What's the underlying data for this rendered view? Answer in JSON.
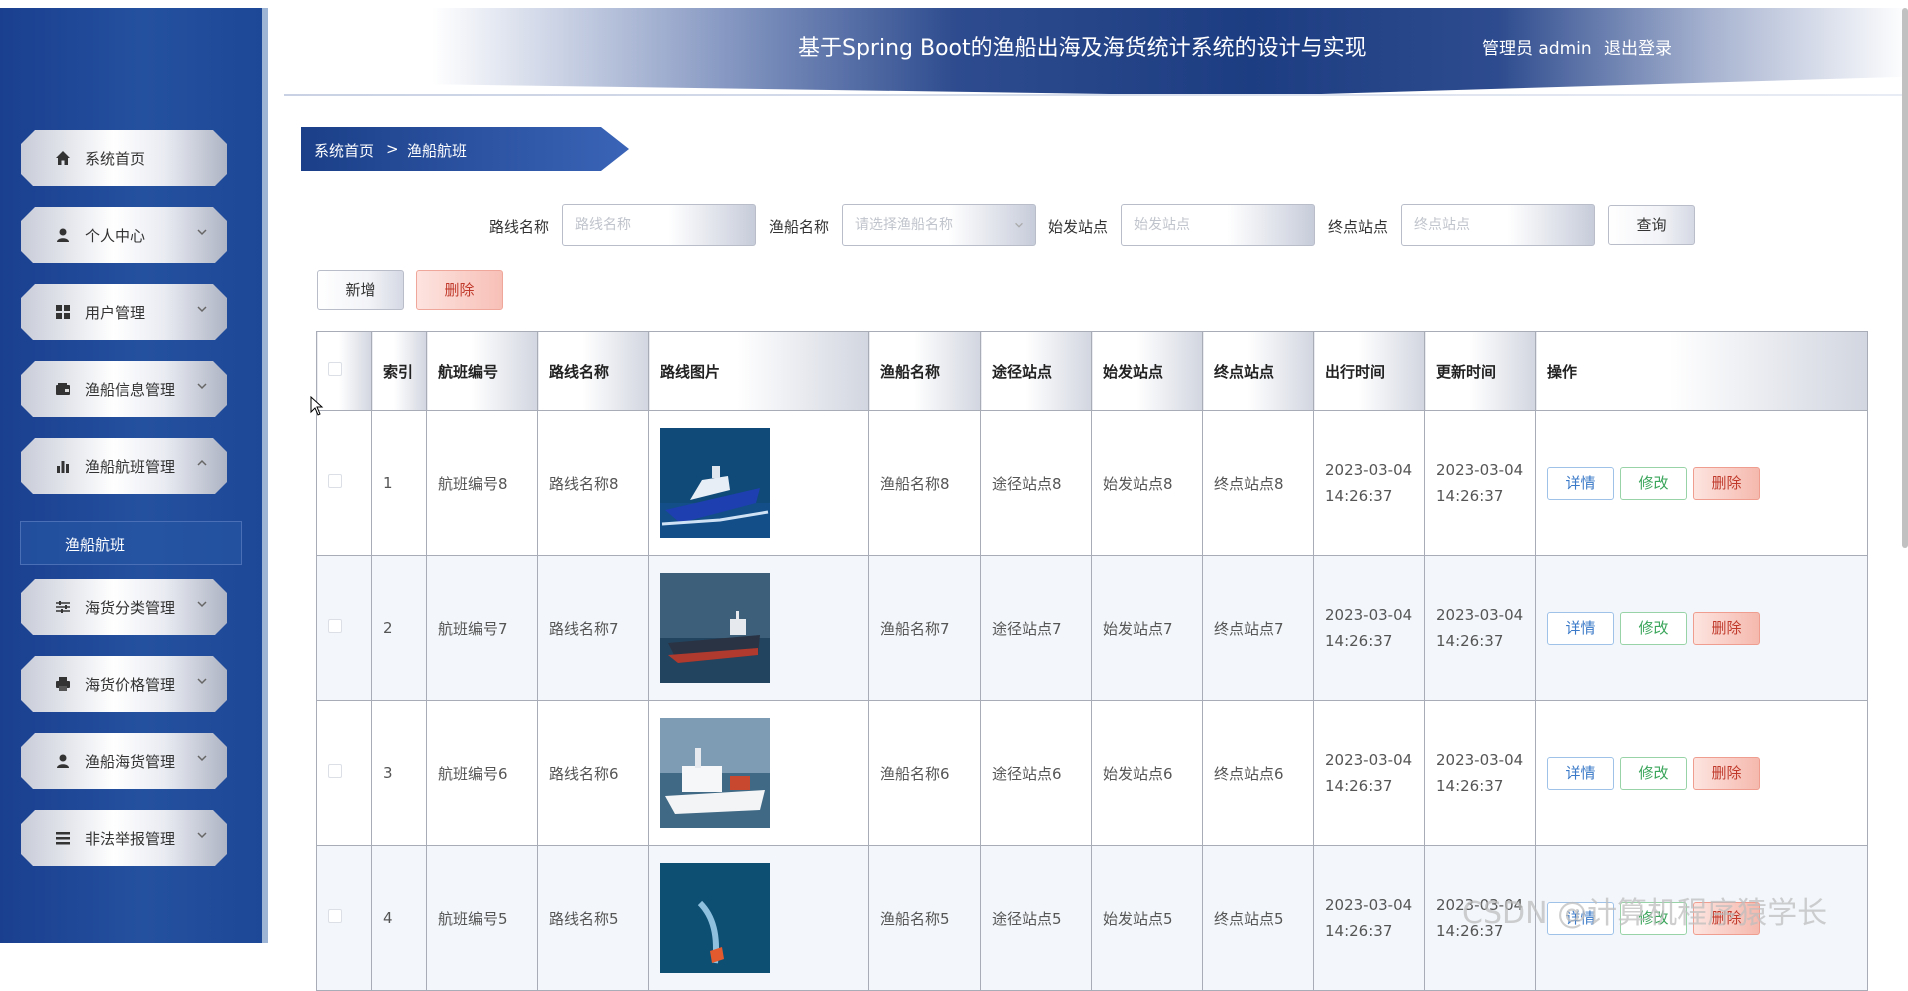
{
  "header": {
    "title": "基于Spring Boot的渔船出海及海货统计系统的设计与实现",
    "user": "管理员 admin",
    "logout": "退出登录"
  },
  "sidebar": {
    "items": [
      {
        "label": "系统首页",
        "icon": "home-icon"
      },
      {
        "label": "个人中心",
        "icon": "user-icon"
      },
      {
        "label": "用户管理",
        "icon": "grid-icon"
      },
      {
        "label": "渔船信息管理",
        "icon": "wallet-icon"
      },
      {
        "label": "渔船航班管理",
        "icon": "bar-chart-icon"
      },
      {
        "label": "海货分类管理",
        "icon": "sliders-icon"
      },
      {
        "label": "海货价格管理",
        "icon": "printer-icon"
      },
      {
        "label": "渔船海货管理",
        "icon": "user-icon"
      },
      {
        "label": "非法举报管理",
        "icon": "list-icon"
      }
    ],
    "submenu_item": "渔船航班"
  },
  "breadcrumb": {
    "home": "系统首页",
    "sep": ">",
    "current": "渔船航班"
  },
  "search": {
    "route_label": "路线名称",
    "route_placeholder": "路线名称",
    "boat_label": "渔船名称",
    "boat_placeholder": "请选择渔船名称",
    "start_label": "始发站点",
    "start_placeholder": "始发站点",
    "end_label": "终点站点",
    "end_placeholder": "终点站点",
    "query_button": "查询"
  },
  "actions": {
    "add": "新增",
    "delete": "删除"
  },
  "table": {
    "headers": {
      "index": "索引",
      "flight_no": "航班编号",
      "route_name": "路线名称",
      "route_image": "路线图片",
      "boat_name": "渔船名称",
      "via": "途径站点",
      "start": "始发站点",
      "end": "终点站点",
      "depart_time": "出行时间",
      "update_time": "更新时间",
      "ops": "操作"
    },
    "rows": [
      {
        "index": "1",
        "flight_no": "航班编号8",
        "route_name": "路线名称8",
        "boat_name": "渔船名称8",
        "via": "途径站点8",
        "start": "始发站点8",
        "end": "终点站点8",
        "depart_date": "2023-03-04",
        "depart_clock": "14:26:37",
        "update_date": "2023-03-04",
        "update_clock": "14:26:37"
      },
      {
        "index": "2",
        "flight_no": "航班编号7",
        "route_name": "路线名称7",
        "boat_name": "渔船名称7",
        "via": "途径站点7",
        "start": "始发站点7",
        "end": "终点站点7",
        "depart_date": "2023-03-04",
        "depart_clock": "14:26:37",
        "update_date": "2023-03-04",
        "update_clock": "14:26:37"
      },
      {
        "index": "3",
        "flight_no": "航班编号6",
        "route_name": "路线名称6",
        "boat_name": "渔船名称6",
        "via": "途径站点6",
        "start": "始发站点6",
        "end": "终点站点6",
        "depart_date": "2023-03-04",
        "depart_clock": "14:26:37",
        "update_date": "2023-03-04",
        "update_clock": "14:26:37"
      },
      {
        "index": "4",
        "flight_no": "航班编号5",
        "route_name": "路线名称5",
        "boat_name": "渔船名称5",
        "via": "途径站点5",
        "start": "始发站点5",
        "end": "终点站点5",
        "depart_date": "2023-03-04",
        "depart_clock": "14:26:37",
        "update_date": "2023-03-04",
        "update_clock": "14:26:37"
      }
    ],
    "row_actions": {
      "detail": "详情",
      "edit": "修改",
      "delete": "删除"
    }
  },
  "watermark": "CSDN @计算机程序猿学长",
  "colors": {
    "sidebar": "#1f4a9a",
    "header": "#1d3d82",
    "danger": "#c0392b",
    "success": "#3aa55a",
    "info": "#3a79c8"
  }
}
